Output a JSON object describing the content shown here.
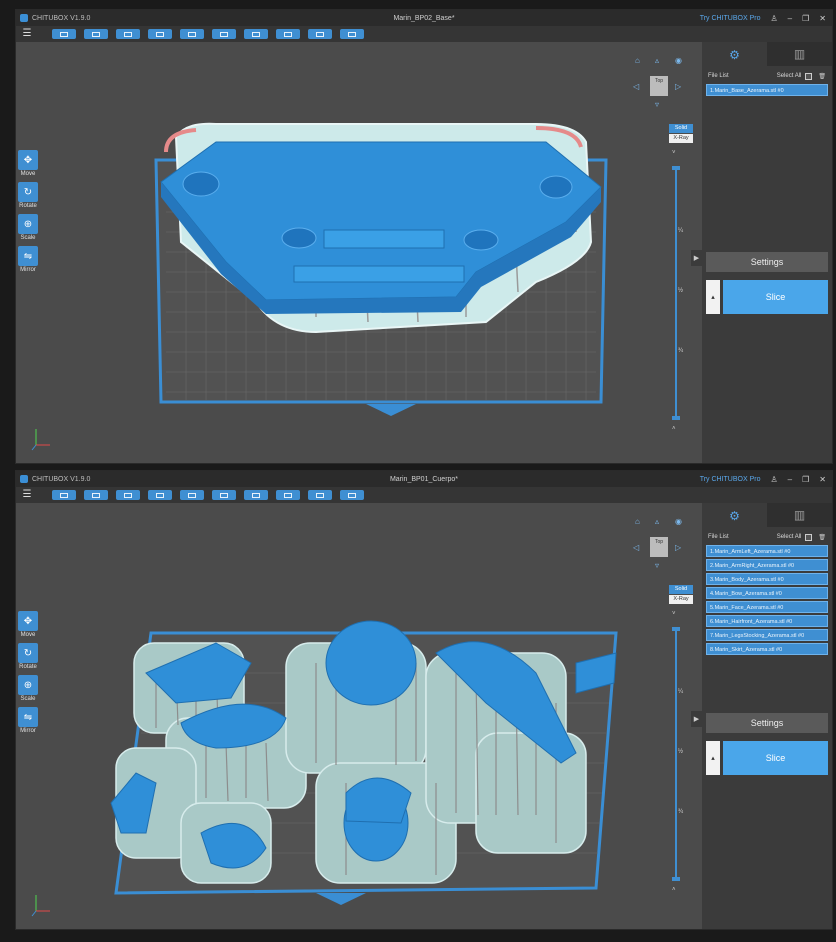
{
  "windows": [
    {
      "app_title": "CHITUBOX V1.9.0",
      "document_title": "Marin_BP02_Base*",
      "try_pro": "Try CHITUBOX Pro",
      "file_list_label": "File List",
      "select_all_label": "Select All",
      "files": [
        "1.Marin_Base_Azerama.stl #0"
      ],
      "view_cube_label": "Top",
      "mode_solid": "Solid",
      "mode_xray": "X-Ray",
      "slider_ticks": [
        "¼",
        "½",
        "¾"
      ],
      "tools": [
        "Move",
        "Rotate",
        "Scale",
        "Mirror"
      ],
      "settings_label": "Settings",
      "slice_label": "Slice"
    },
    {
      "app_title": "CHITUBOX V1.9.0",
      "document_title": "Marin_BP01_Cuerpo*",
      "try_pro": "Try CHITUBOX Pro",
      "file_list_label": "File List",
      "select_all_label": "Select All",
      "files": [
        "1.Marin_ArmLeft_Azerama.stl #0",
        "2.Marin_ArmRight_Azerama.stl #0",
        "3.Marin_Body_Azerama.stl #0",
        "4.Marin_Bow_Azerama.stl #0",
        "5.Marin_Face_Azerama.stl #0",
        "6.Marin_Hairfront_Azerama.stl #0",
        "7.Marin_LegsStocking_Azerama.stl #0",
        "8.Marin_Skirt_Azerama.stl #0"
      ],
      "view_cube_label": "Top",
      "mode_solid": "Solid",
      "mode_xray": "X-Ray",
      "slider_ticks": [
        "¼",
        "½",
        "¾"
      ],
      "tools": [
        "Move",
        "Rotate",
        "Scale",
        "Mirror"
      ],
      "settings_label": "Settings",
      "slice_label": "Slice"
    }
  ],
  "colors": {
    "accent": "#3f8fd2",
    "model": "#2f8fd8",
    "support": "#b9e4e6",
    "plate_border": "#3a8ed4",
    "background": "#4b4b4b"
  },
  "icons": [
    "menu-icon",
    "file-icon",
    "settings-icon",
    "printer-icon",
    "home-view-icon",
    "eye-icon",
    "trash-icon",
    "move-icon",
    "rotate-icon",
    "scale-icon",
    "mirror-icon"
  ]
}
